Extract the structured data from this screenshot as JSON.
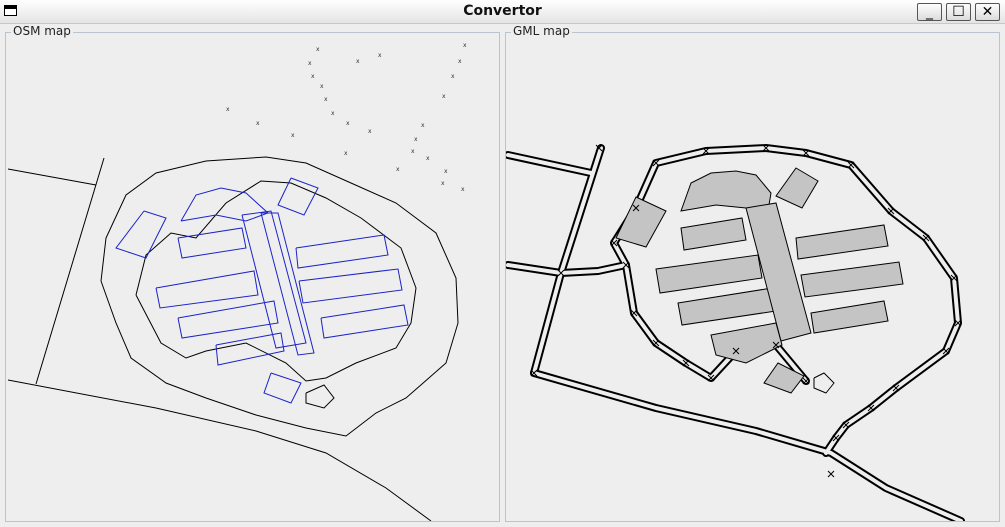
{
  "window": {
    "title": "Convertor"
  },
  "controls": {
    "minimize": "_",
    "maximize": "☐",
    "close": "✕"
  },
  "panels": {
    "osm_title": "OSM map",
    "gml_title": "GML map"
  },
  "icons": [
    "app-window-icon",
    "minimize-icon",
    "maximize-icon",
    "close-icon"
  ],
  "colors": {
    "osm_road": "#000000",
    "osm_building": "#1c23c8",
    "gml_road_fill": "#eeeeee",
    "gml_building_fill": "#c4c4c4"
  }
}
